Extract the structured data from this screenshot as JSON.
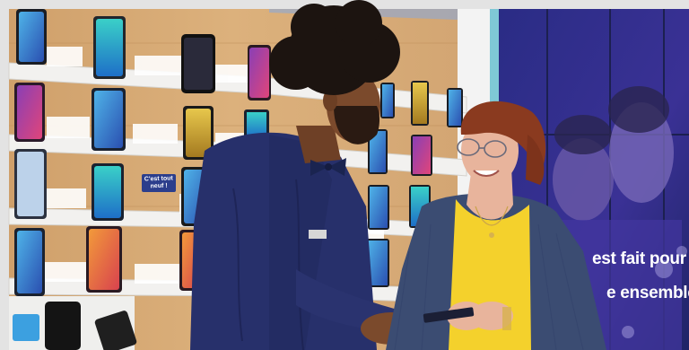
{
  "scene": {
    "setting": "phone-shop",
    "palette": {
      "wall": "#d9ae7a",
      "shelf": "#f1f1ef",
      "shirt": "#26306a",
      "cardigan": "#3b4c72",
      "top": "#f4d12c",
      "hair": "#1c1410",
      "skin_dark": "#7b4a2c",
      "skin_light": "#e8b49c",
      "ad_panel": "#2d2a7d"
    }
  },
  "shelf_tag": {
    "text": "C'est tout neuf !"
  },
  "name_badge": {
    "text": ""
  },
  "poster": {
    "line1": "est fait pour",
    "line2": "e ensemble"
  }
}
